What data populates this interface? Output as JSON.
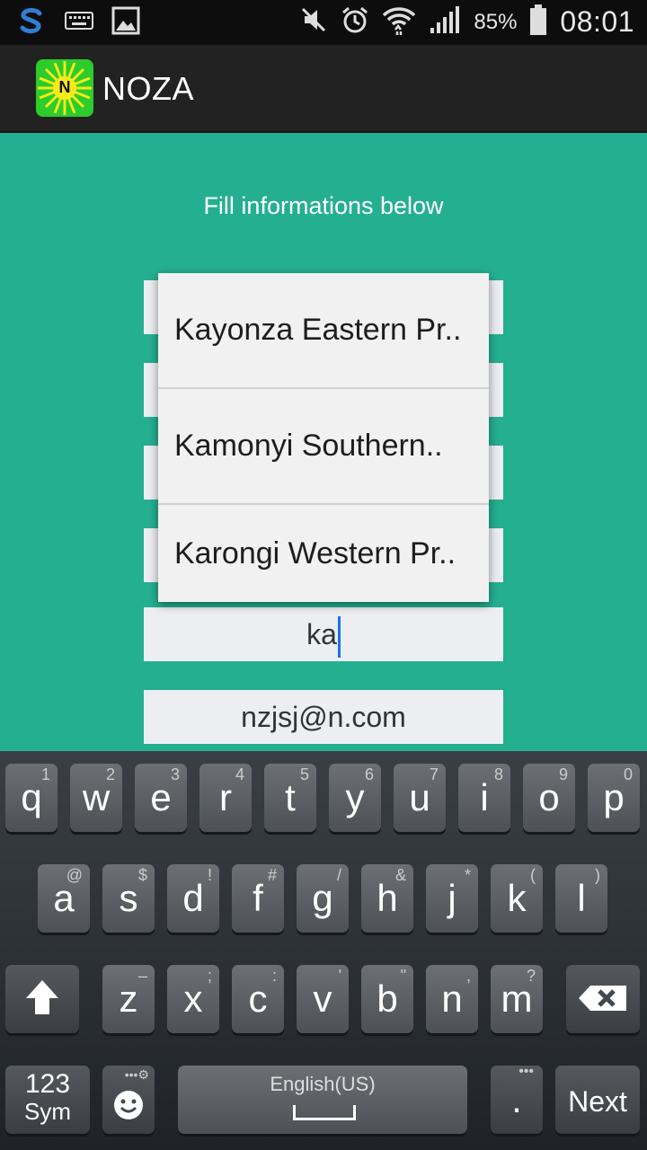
{
  "status_bar": {
    "time": "08:01",
    "battery_percent": "85%",
    "icons": [
      "s-app-icon",
      "keyboard-icon",
      "image-icon",
      "mute-icon",
      "alarm-icon",
      "wifi-icon",
      "signal-icon",
      "battery-icon"
    ]
  },
  "action_bar": {
    "logo_letter": "N",
    "title": "NOZA"
  },
  "form": {
    "prompt": "Fill informations below",
    "district_value": "ka",
    "email_value": "nzjsj@n.com"
  },
  "dropdown": {
    "items": [
      "Kayonza Eastern Pr..",
      "Kamonyi Southern..",
      "Karongi Western Pr.."
    ]
  },
  "keyboard": {
    "row1": [
      [
        "q",
        "1"
      ],
      [
        "w",
        "2"
      ],
      [
        "e",
        "3"
      ],
      [
        "r",
        "4"
      ],
      [
        "t",
        "5"
      ],
      [
        "y",
        "6"
      ],
      [
        "u",
        "7"
      ],
      [
        "i",
        "8"
      ],
      [
        "o",
        "9"
      ],
      [
        "p",
        "0"
      ]
    ],
    "row2": [
      [
        "a",
        "@"
      ],
      [
        "s",
        "$"
      ],
      [
        "d",
        "!"
      ],
      [
        "f",
        "#"
      ],
      [
        "g",
        "/"
      ],
      [
        "h",
        "&"
      ],
      [
        "j",
        "*"
      ],
      [
        "k",
        "("
      ],
      [
        "l",
        ")"
      ]
    ],
    "row3": [
      [
        "z",
        "–"
      ],
      [
        "x",
        ";"
      ],
      [
        "c",
        ":"
      ],
      [
        "v",
        "'"
      ],
      [
        "b",
        "\""
      ],
      [
        "n",
        ","
      ],
      [
        "m",
        "?"
      ]
    ],
    "sym_label_top": "123",
    "sym_label_bottom": "Sym",
    "space_label": "English(US)",
    "period": ".",
    "next_label": "Next"
  },
  "colors": {
    "background": "#25af91",
    "action_bar": "#222222",
    "cursor": "#1a73e8"
  }
}
